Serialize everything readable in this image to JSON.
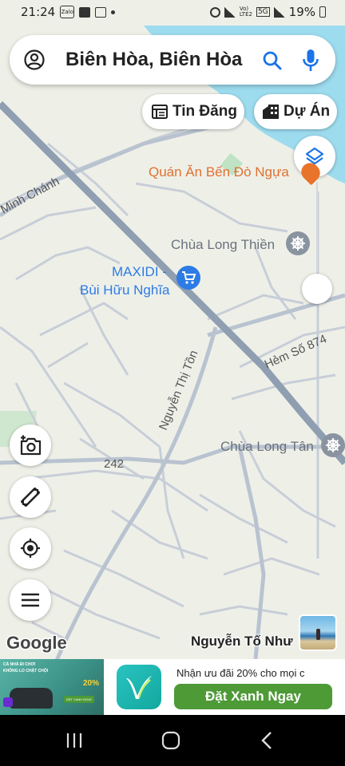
{
  "status": {
    "time": "21:24",
    "app_icon_label": "Zalo",
    "battery": "19%",
    "network_top": "Vo)",
    "network_bottom": "LTE2",
    "network_type": "5G"
  },
  "search": {
    "query": "Biên Hòa, Biên Hòa",
    "icons": [
      "account-icon",
      "search-icon",
      "mic-icon"
    ]
  },
  "chips": {
    "tin_dang": "Tin Đăng",
    "du_an": "Dự Án"
  },
  "map_labels": {
    "restaurant": "Quán Ăn Bến Đò Ngựa",
    "pagoda1": "Chùa Long Thiền",
    "store_line1": "MAXIDI -",
    "store_line2": "Bùi Hữu Nghĩa",
    "street_minh_chanh": "Minh Chánh",
    "street_hem": "Hẻm Số 874",
    "street_nguyen_thi_ton": "Nguyễn Thị Tồn",
    "pagoda2": "Chùa Long Tân",
    "road_number": "242",
    "google": "Google",
    "photo_author": "Nguyễn Tố Như"
  },
  "ad": {
    "title": "Nhận ưu đãi 20% cho mọi c",
    "button": "Đặt Xanh Ngay",
    "thumb_line1": "CÀ NHÀ ĐI CHƠI",
    "thumb_line2": "KHÔNG LO CHẬT CHỘI",
    "thumb_badge": "20%",
    "thumb_button": "ĐẶT XANH NGAY"
  },
  "colors": {
    "map_bg": "#eef0e8",
    "road": "#8f9fb1",
    "water": "#9ddcef",
    "poi_orange": "#e8732a",
    "poi_gray": "#8a94a0",
    "store_blue": "#2d7be5",
    "ad_green": "#4d9a37"
  }
}
